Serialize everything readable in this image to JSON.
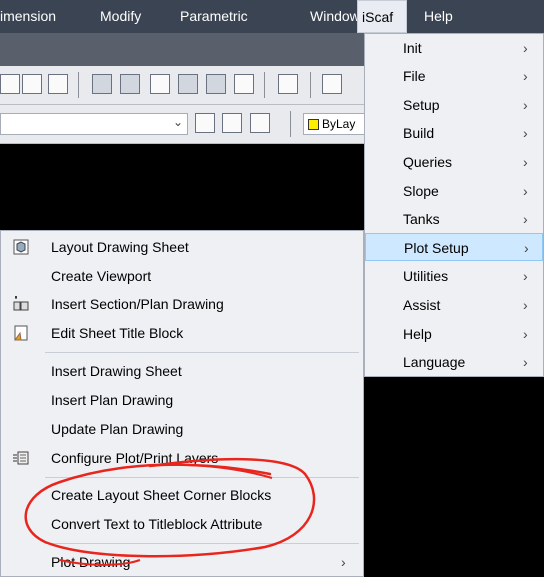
{
  "menubar": {
    "items": [
      "imension",
      "Modify",
      "Parametric",
      "Window",
      "iScaf",
      "Help"
    ]
  },
  "toolbar": {
    "bylayer_label": "ByLay",
    "bylayer_color": "#ffee00"
  },
  "iscaf_menu": {
    "items": [
      {
        "label": "Init",
        "chevron": "›"
      },
      {
        "label": "File",
        "chevron": "›"
      },
      {
        "label": "Setup",
        "chevron": "›"
      },
      {
        "label": "Build",
        "chevron": "›"
      },
      {
        "label": "Queries",
        "chevron": "›"
      },
      {
        "label": "Slope",
        "chevron": "›"
      },
      {
        "label": "Tanks",
        "chevron": "›"
      },
      {
        "label": "Plot Setup",
        "chevron": "›"
      },
      {
        "label": "Utilities",
        "chevron": "›"
      },
      {
        "label": "Assist",
        "chevron": "›"
      },
      {
        "label": "Help",
        "chevron": "›"
      },
      {
        "label": "Language",
        "chevron": "›"
      }
    ],
    "highlighted": "Plot Setup"
  },
  "plot_setup_menu": {
    "items": [
      {
        "label": "Layout Drawing Sheet",
        "icon": "layout-sheet-icon"
      },
      {
        "label": "Create Viewport"
      },
      {
        "label": "Insert Section/Plan Drawing",
        "icon": "insert-drawing-icon"
      },
      {
        "label": "Edit Sheet Title Block",
        "icon": "title-block-icon"
      },
      {
        "label": "Insert Drawing Sheet"
      },
      {
        "label": "Insert Plan Drawing"
      },
      {
        "label": "Update Plan Drawing"
      },
      {
        "label": "Configure Plot/Print Layers",
        "icon": "layers-icon"
      },
      {
        "label": "Create Layout Sheet Corner Blocks"
      },
      {
        "label": "Convert Text to Titleblock Attribute"
      },
      {
        "label": "Plot Drawing",
        "chevron": "›"
      }
    ]
  },
  "colors": {
    "menubar_bg": "#3b4453",
    "menu_bg": "#eef0f4",
    "highlight_bg": "#cde8ff",
    "annotation": "#e8261d"
  }
}
